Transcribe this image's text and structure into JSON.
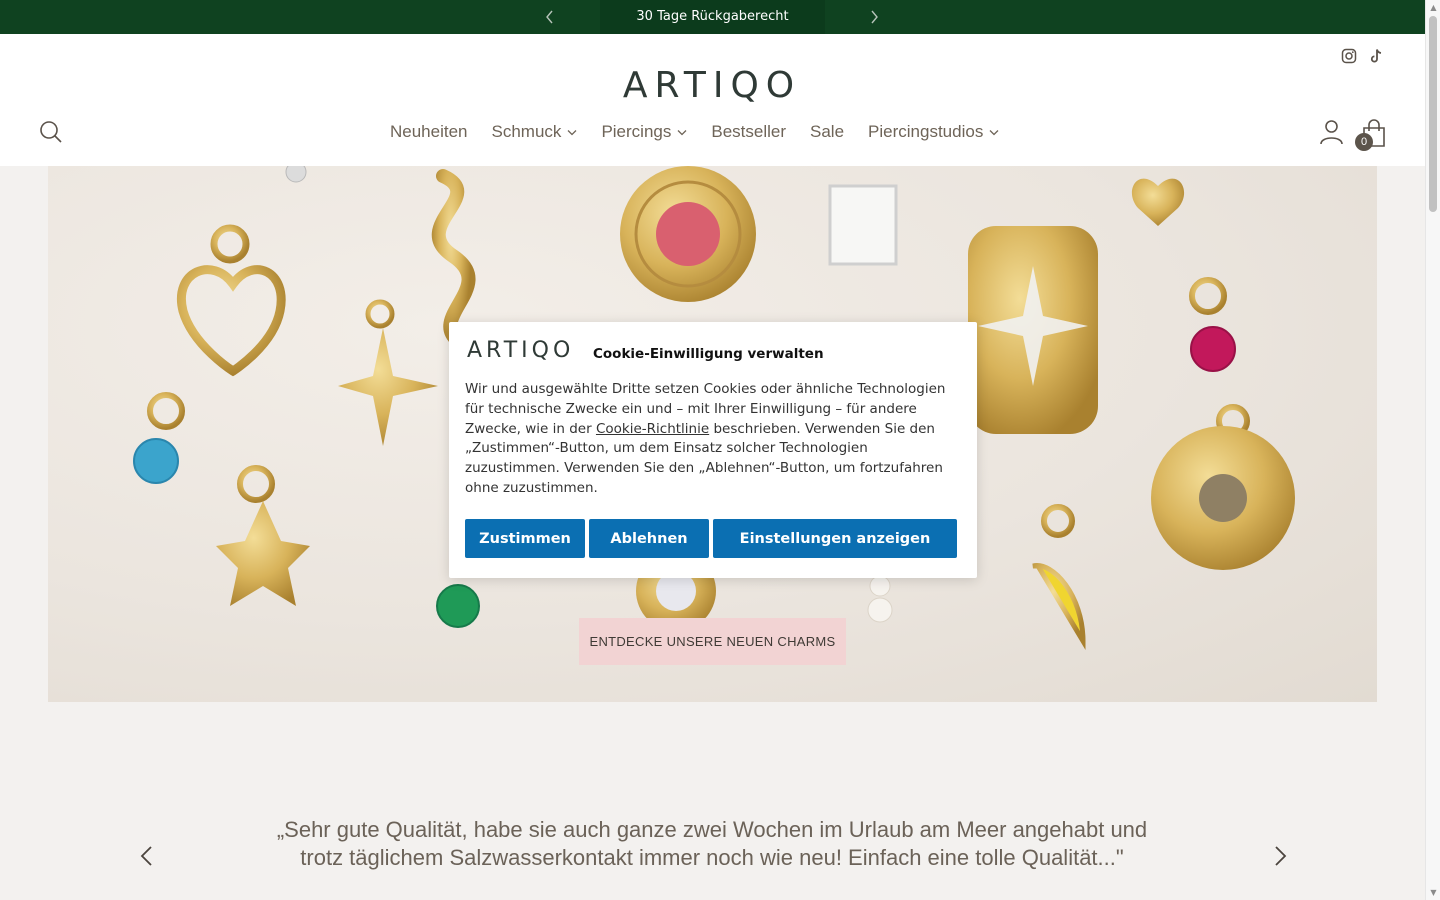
{
  "announcement": {
    "text": "30 Tage Rückgaberecht",
    "prev_icon": "chevron-left-icon",
    "next_icon": "chevron-right-icon"
  },
  "header": {
    "logo_text": "ARTIQO",
    "social": [
      "instagram-icon",
      "tiktok-icon"
    ],
    "nav": [
      {
        "label": "Neuheiten",
        "has_dropdown": false
      },
      {
        "label": "Schmuck",
        "has_dropdown": true
      },
      {
        "label": "Piercings",
        "has_dropdown": true
      },
      {
        "label": "Bestseller",
        "has_dropdown": false
      },
      {
        "label": "Sale",
        "has_dropdown": false
      },
      {
        "label": "Piercingstudios",
        "has_dropdown": true
      }
    ],
    "cart_count": "0"
  },
  "hero": {
    "cta_label": "ENTDECKE UNSERE NEUEN CHARMS"
  },
  "testimonial": {
    "quote": "„Sehr gute Qualität, habe sie auch ganze zwei Wochen im Urlaub am Meer angehabt und trotz täglichem Salzwasserkontakt immer noch wie neu! Einfach eine tolle Qualität...\""
  },
  "cookie": {
    "logo_text": "ARTIQO",
    "title": "Cookie-Einwilligung verwalten",
    "body_before_link": "Wir und ausgewählte Dritte setzen Cookies oder ähnliche Technologien für technische Zwecke ein und – mit Ihrer Einwilligung – für andere Zwecke, wie in der ",
    "link_text": "Cookie-Richtlinie",
    "body_after_link": " beschrieben. Verwenden Sie den „Zustimmen“-Button, um dem Einsatz solcher Technologien zuzustimmen. Verwenden Sie den „Ablehnen“-Button, um fortzufahren ohne zuzustimmen.",
    "accept_label": "Zustimmen",
    "reject_label": "Ablehnen",
    "settings_label": "Einstellungen anzeigen"
  },
  "colors": {
    "announcement_bg": "#0f4220",
    "cta_bg": "#f2d3d3",
    "cookie_button": "#0b6fb2",
    "gold": "#d8b35a"
  }
}
